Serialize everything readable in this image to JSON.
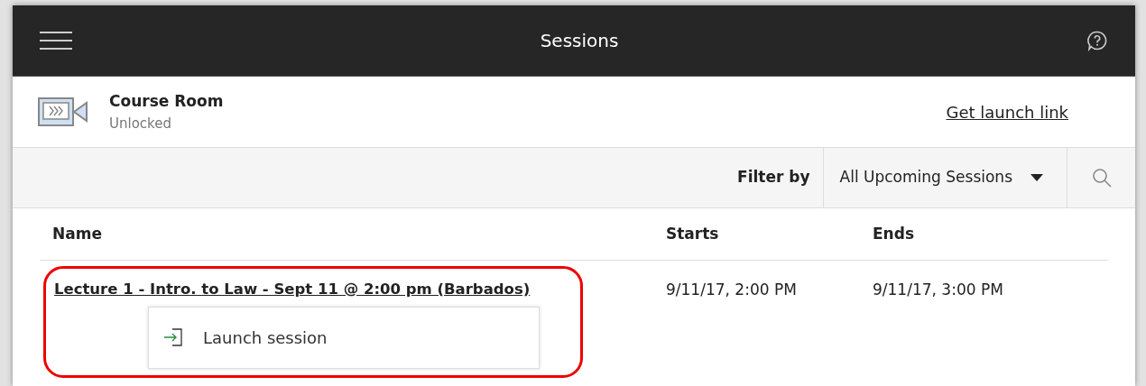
{
  "header": {
    "title": "Sessions"
  },
  "room": {
    "name": "Course Room",
    "status": "Unlocked",
    "link": "Get launch link"
  },
  "filter": {
    "label": "Filter by",
    "value": "All Upcoming Sessions"
  },
  "table": {
    "columns": [
      "Name",
      "Starts",
      "Ends"
    ],
    "rows": [
      {
        "name": "Lecture 1 - Intro. to Law - Sept 11 @ 2:00 pm (Barbados)",
        "starts": "9/11/17, 2:00 PM",
        "ends": "9/11/17, 3:00 PM",
        "highlighted": true,
        "menu": [
          {
            "label": "Launch session"
          }
        ]
      }
    ]
  }
}
